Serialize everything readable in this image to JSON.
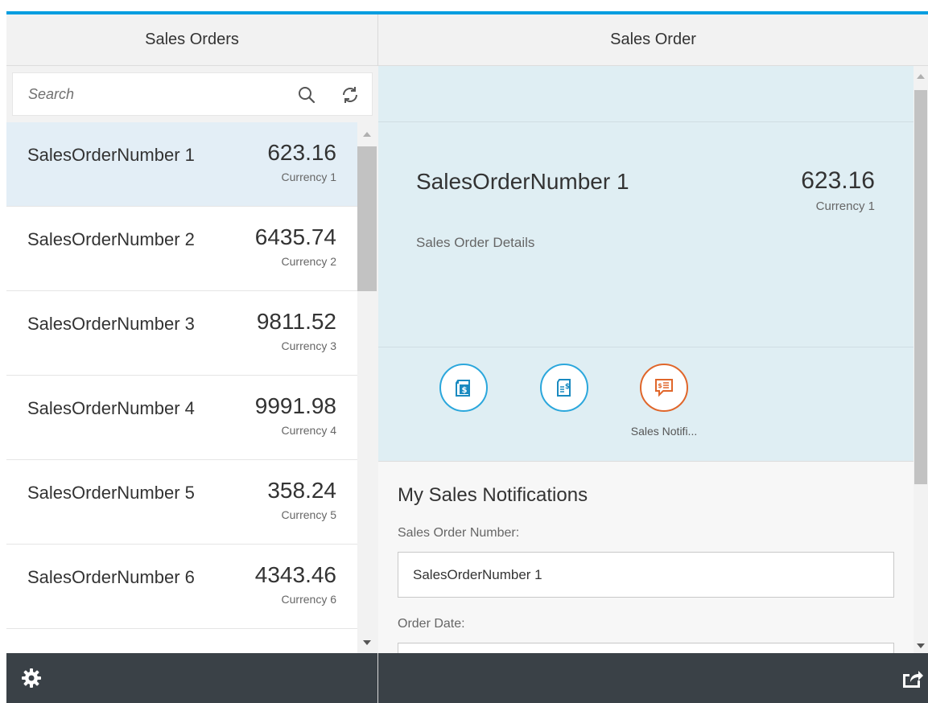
{
  "master": {
    "title": "Sales Orders",
    "search": {
      "placeholder": "Search",
      "value": ""
    },
    "items": [
      {
        "title": "SalesOrderNumber 1",
        "amount": "623.16",
        "currency": "Currency 1",
        "selected": true
      },
      {
        "title": "SalesOrderNumber 2",
        "amount": "6435.74",
        "currency": "Currency 2"
      },
      {
        "title": "SalesOrderNumber 3",
        "amount": "9811.52",
        "currency": "Currency 3"
      },
      {
        "title": "SalesOrderNumber 4",
        "amount": "9991.98",
        "currency": "Currency 4"
      },
      {
        "title": "SalesOrderNumber 5",
        "amount": "358.24",
        "currency": "Currency 5"
      },
      {
        "title": "SalesOrderNumber 6",
        "amount": "4343.46",
        "currency": "Currency 6"
      },
      {
        "title": "",
        "amount": "",
        "currency": ""
      }
    ],
    "footer_icon": "gear-icon"
  },
  "detail": {
    "title": "Sales Order",
    "header": {
      "title": "SalesOrderNumber 1",
      "amount": "623.16",
      "currency": "Currency 1",
      "subtitle": "Sales Order Details"
    },
    "tabs": [
      {
        "icon": "invoice-dollar-icon",
        "label": ""
      },
      {
        "icon": "document-dollar-icon",
        "label": ""
      },
      {
        "icon": "notification-dollar-icon",
        "label": "Sales Notifi...",
        "active": true
      }
    ],
    "form": {
      "title": "My Sales Notifications",
      "order_number_label": "Sales Order Number:",
      "order_number_value": "SalesOrderNumber 1",
      "order_date_label": "Order Date:"
    },
    "footer_icon": "share-icon"
  },
  "colors": {
    "accent": "#009de0",
    "active_tab": "#e0662a",
    "footer": "#3a4147",
    "selected_row": "#e3eef6"
  }
}
